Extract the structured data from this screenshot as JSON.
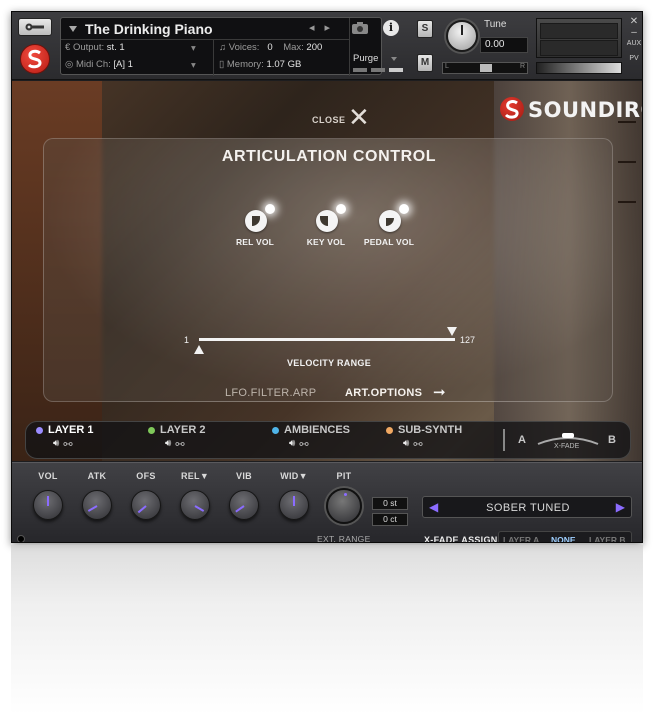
{
  "header": {
    "instrument_title": "The Drinking Piano",
    "output_label": "Output:",
    "output_value": "st. 1",
    "voices_label": "Voices:",
    "voices_value": "0",
    "max_label": "Max:",
    "max_value": "200",
    "purge_label": "Purge",
    "midi_label": "Midi Ch:",
    "midi_value": "[A] 1",
    "memory_label": "Memory:",
    "memory_value": "1.07 GB",
    "s_button": "S",
    "m_button": "M",
    "tune_label": "Tune",
    "tune_value": "0.00",
    "pan_left": "L",
    "pan_right": "R",
    "aux_label": "AUX",
    "pv_label": "PV"
  },
  "scene": {
    "close_label": "CLOSE",
    "brand_name": "SOUNDIRON"
  },
  "articulation": {
    "title": "ARTICULATION CONTROL",
    "knobs": [
      {
        "label": "REL VOL"
      },
      {
        "label": "KEY VOL"
      },
      {
        "label": "PEDAL VOL"
      }
    ],
    "velocity_min": "1",
    "velocity_max": "127",
    "velocity_label": "VELOCITY RANGE",
    "nav_lfo": "LFO.FILTER.ARP",
    "nav_art": "ART.OPTIONS"
  },
  "layers": [
    {
      "name": "LAYER 1",
      "color": "#9b8cff",
      "active": true
    },
    {
      "name": "LAYER 2",
      "color": "#7fc95a",
      "active": false
    },
    {
      "name": "AMBIENCES",
      "color": "#4fb4e8",
      "active": false
    },
    {
      "name": "SUB-SYNTH",
      "color": "#f0a862",
      "active": false
    }
  ],
  "xfade": {
    "a_label": "A",
    "b_label": "B",
    "label": "X-FADE"
  },
  "controls": {
    "knobs": [
      {
        "label": "VOL"
      },
      {
        "label": "ATK"
      },
      {
        "label": "OFS"
      },
      {
        "label": "REL▼"
      },
      {
        "label": "VIB"
      },
      {
        "label": "WID▼"
      }
    ],
    "pit_label": "PIT",
    "pit_st": "0 st",
    "pit_ct": "0 ct",
    "ext_range": "EXT. RANGE",
    "preset_name": "SOBER TUNED",
    "xfade_assign_label": "X-FADE ASSIGN",
    "xfade_options": [
      "LAYER A",
      "NONE",
      "LAYER B"
    ],
    "xfade_selected": "NONE"
  },
  "colors": {
    "accent": "#8b6cff",
    "brand_red": "#d62b20",
    "selected": "#9ecfff"
  }
}
